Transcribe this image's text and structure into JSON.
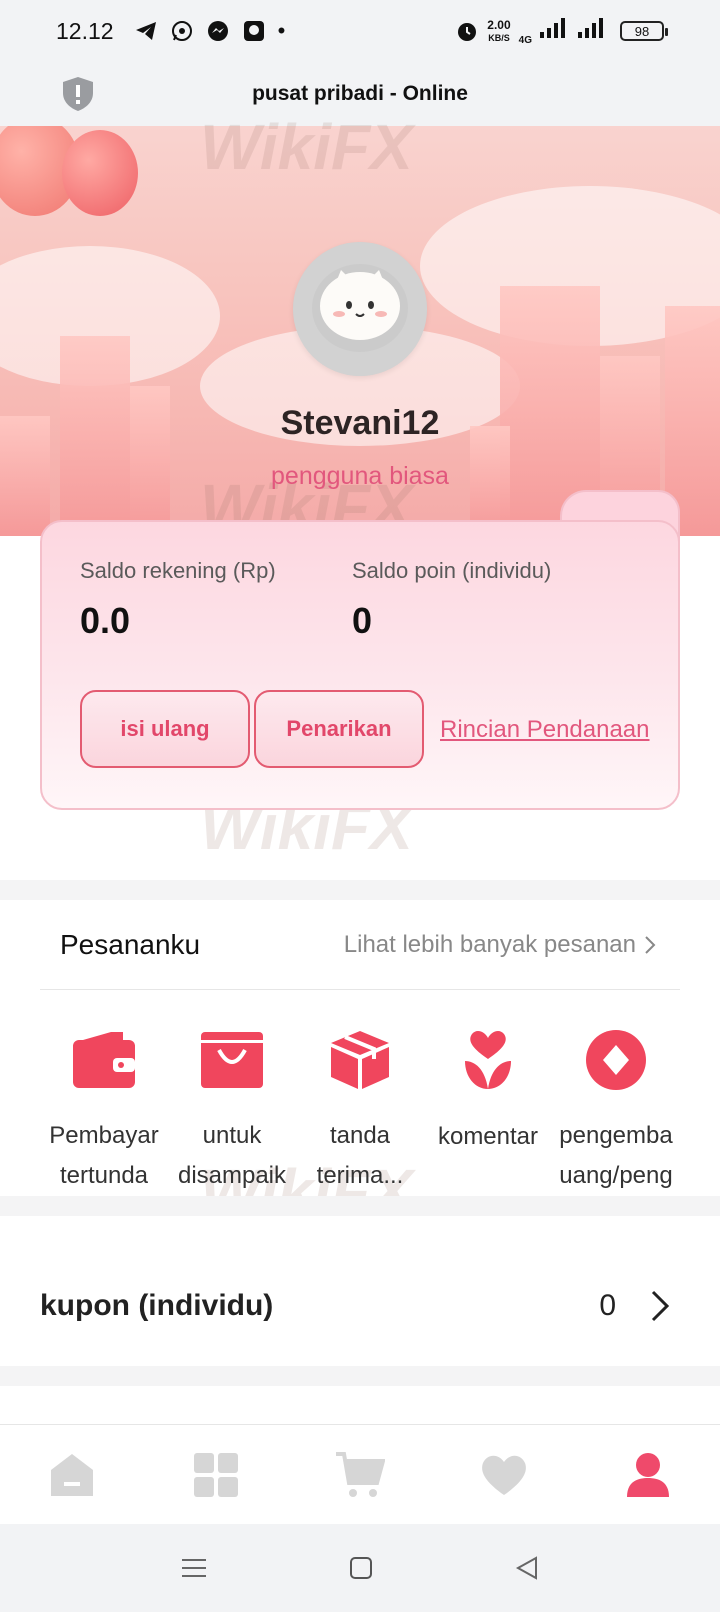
{
  "status_bar": {
    "time": "12.12",
    "notification_icons": [
      "telegram-icon",
      "whatsapp-icon",
      "messenger-icon",
      "app-icon"
    ],
    "net_speed_value": "2.00",
    "net_speed_unit": "KB/S",
    "network_type": "4G",
    "battery": "98"
  },
  "header": {
    "title": "pusat pribadi - Online",
    "icon": "shield-icon"
  },
  "profile": {
    "username": "Stevani12",
    "level": "pengguna biasa"
  },
  "balance": {
    "account_label": "Saldo rekening (Rp)",
    "account_value": "0.0",
    "points_label": "Saldo poin (individu)",
    "points_value": "0",
    "topup_label": "isi ulang",
    "withdraw_label": "Penarikan",
    "details_link": "Rincian Pendanaan"
  },
  "orders": {
    "title": "Pesananku",
    "more": "Lihat lebih banyak pesanan",
    "items": [
      {
        "icon": "wallet-icon",
        "line1": "Pembayar",
        "line2": "tertunda"
      },
      {
        "icon": "shopping-bag-icon",
        "line1": "untuk",
        "line2": "disampaik"
      },
      {
        "icon": "package-icon",
        "line1": "tanda",
        "line2": "terima..."
      },
      {
        "icon": "flower-icon",
        "line1": "komentar",
        "line2": ""
      },
      {
        "icon": "refund-icon",
        "line1": "pengemba",
        "line2": "uang/peng"
      }
    ]
  },
  "coupon": {
    "label": "kupon (individu)",
    "count": "0"
  },
  "bottom_nav": [
    "home-icon",
    "category-icon",
    "cart-icon",
    "favorite-icon",
    "profile-icon"
  ],
  "watermark": "WikiFX",
  "colors": {
    "accent": "#e2577d",
    "icon_red": "#f0465d",
    "nav_inactive": "#d6d6d6",
    "nav_active": "#ef4a6b"
  }
}
